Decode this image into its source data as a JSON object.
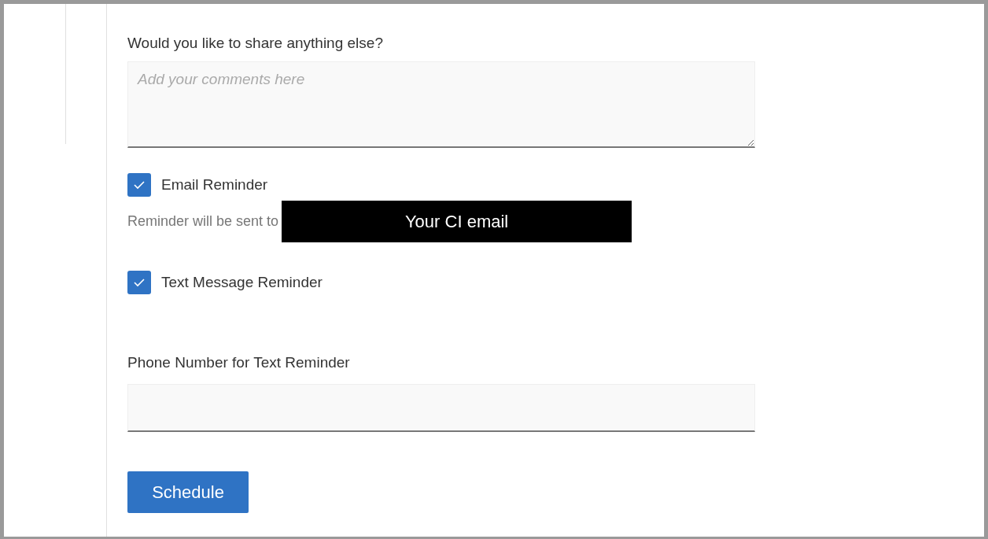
{
  "comments": {
    "label": "Would you like to share anything else?",
    "placeholder": "Add your comments here"
  },
  "reminders": [
    {
      "kind": "email",
      "label": "Email Reminder",
      "checked": true,
      "note": "Reminder will be sent to",
      "email": "Your CI email"
    },
    {
      "kind": "text",
      "label": "Text Message Reminder",
      "checked": true
    }
  ],
  "phone": {
    "label": "Phone Number for Text Reminder"
  },
  "submit": "Schedule"
}
